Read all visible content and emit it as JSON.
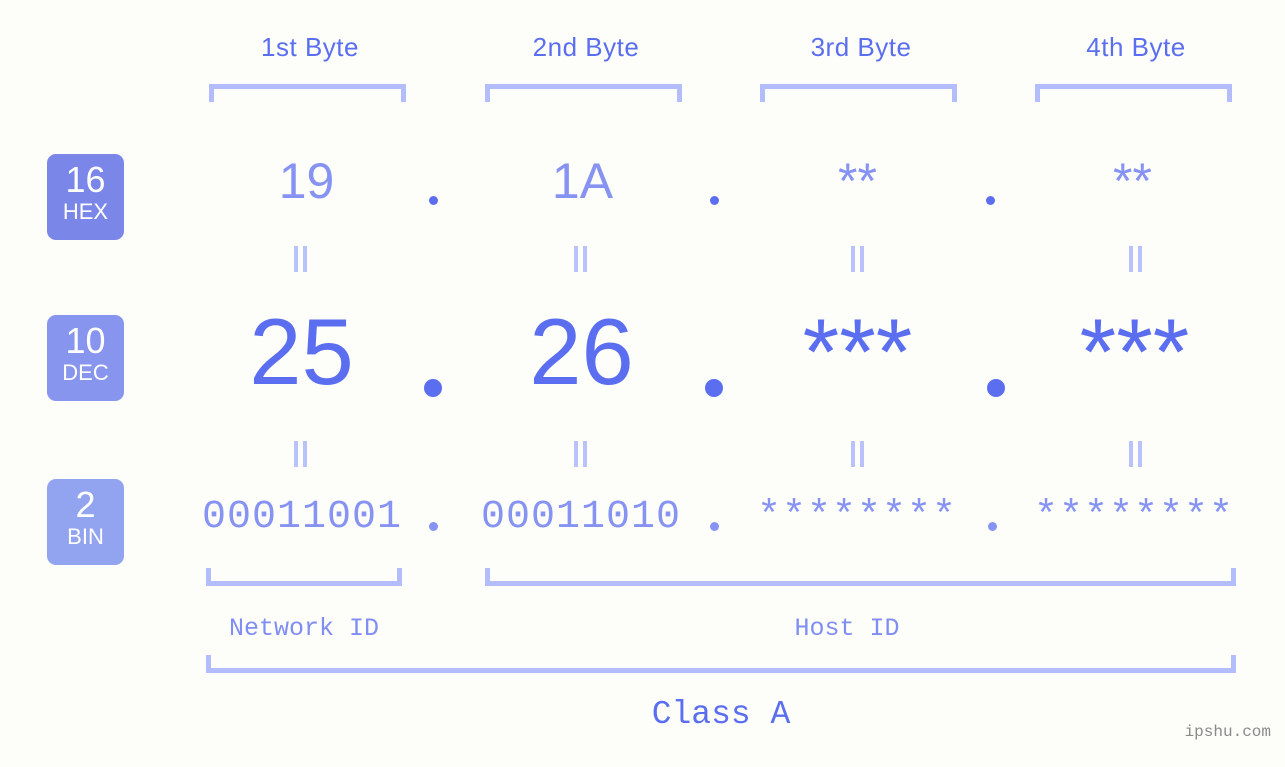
{
  "background_color": "#fdfefa",
  "accent_color": "#5b6ef0",
  "accent_light_color": "#8793f2",
  "bracket_color": "#b3bdfb",
  "byte_headers": [
    {
      "label": "1st Byte"
    },
    {
      "label": "2nd Byte"
    },
    {
      "label": "3rd Byte"
    },
    {
      "label": "4th Byte"
    }
  ],
  "radix_badges": [
    {
      "number": "16",
      "name": "HEX",
      "color": "#7b87e8"
    },
    {
      "number": "10",
      "name": "DEC",
      "color": "#8795ee"
    },
    {
      "number": "2",
      "name": "BIN",
      "color": "#92a4f0"
    }
  ],
  "rows": {
    "hex": {
      "values": [
        "19",
        "1A",
        "**",
        "**"
      ]
    },
    "dec": {
      "values": [
        "25",
        "26",
        "***",
        "***"
      ]
    },
    "bin": {
      "values": [
        "00011001",
        "00011010",
        "********",
        "********"
      ]
    }
  },
  "separators": {
    "dot": "."
  },
  "equals_marks": {
    "symbol": "="
  },
  "sections": [
    {
      "label": "Network ID"
    },
    {
      "label": "Host ID"
    }
  ],
  "class_label": "Class A",
  "watermark": "ipshu.com"
}
